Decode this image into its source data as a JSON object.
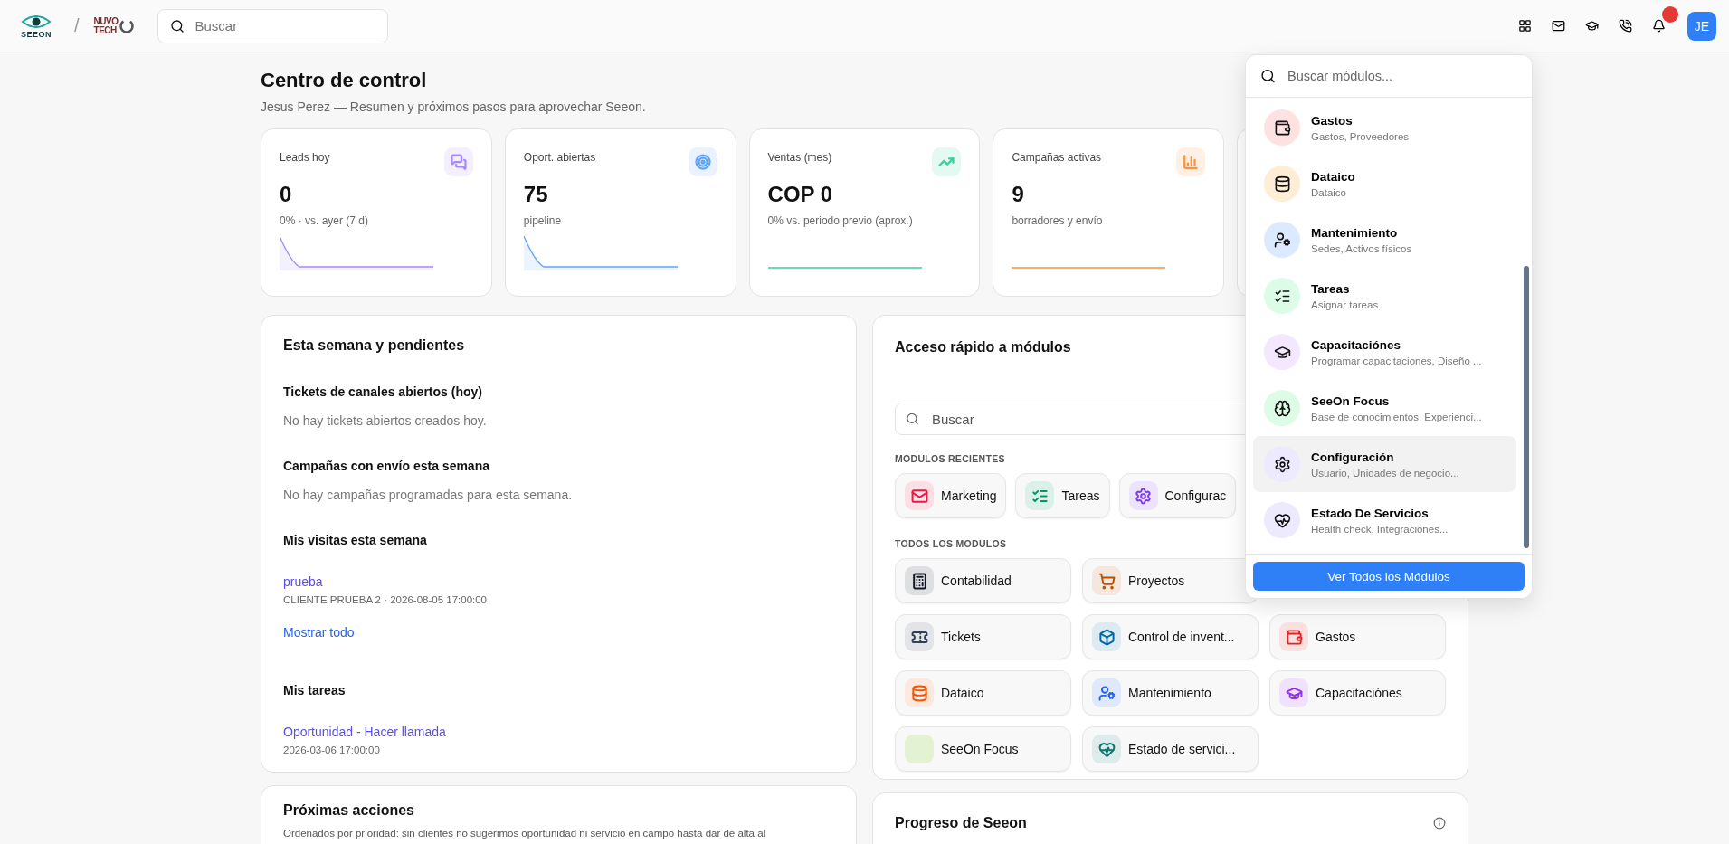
{
  "header": {
    "logo_text": "SEEON",
    "partner_logo_lines": [
      "NUVO",
      "TECH"
    ],
    "separator": "/",
    "search": {
      "placeholder": "Buscar"
    },
    "notification_badge": true,
    "avatar": "JE"
  },
  "page": {
    "title": "Centro de control",
    "subtitle": "Jesus Perez — Resumen y próximos pasos para aprovechar Seeon."
  },
  "stats": [
    {
      "label": "Leads hoy",
      "value": "0",
      "note": "0% · vs. ayer (7 d)",
      "kind": "chat",
      "color": "#a78bfa"
    },
    {
      "label": "Oport. abiertas",
      "value": "75",
      "note": "pipeline",
      "kind": "target",
      "color": "#60a5fa"
    },
    {
      "label": "Ventas (mes)",
      "value": "COP 0",
      "note": "0% vs. periodo previo (aprox.)",
      "kind": "trend",
      "color": "#34d399"
    },
    {
      "label": "Campañas activas",
      "value": "9",
      "note": "borradores y envío",
      "kind": "chart",
      "color": "#fb923c"
    },
    {
      "kind": "hidden"
    }
  ],
  "week": {
    "title": "Esta semana y pendientes",
    "sections": [
      {
        "title": "Tickets de canales abiertos (hoy)",
        "empty": "No hay tickets abiertos creados hoy."
      },
      {
        "title": "Campañas con envío esta semana",
        "empty": "No hay campañas programadas para esta semana."
      },
      {
        "title": "Mis visitas esta semana",
        "items": [
          {
            "link": "prueba",
            "meta": "CLIENTE PRUEBA 2 · 2026-08-05 17:00:00"
          }
        ],
        "more": "Mostrar todo"
      },
      {
        "title": "Mis tareas",
        "items": [
          {
            "link": "Oportunidad - Hacer llamada",
            "meta": "2026-03-06 17:00:00"
          }
        ]
      }
    ]
  },
  "quick_access": {
    "title": "Acceso rápido a módulos",
    "search": {
      "placeholder": "Buscar"
    },
    "recent_label": "MODULOS RECIENTES",
    "recent": [
      {
        "label": "Marketing",
        "kind": "mail",
        "color": "#e11d48"
      },
      {
        "label": "Tareas",
        "kind": "checklist",
        "color": "#059669"
      },
      {
        "label": "Configurac",
        "kind": "gear",
        "color": "#7c3aed"
      }
    ],
    "all_label": "TODOS LOS MODULOS",
    "all_rows": [
      [
        {
          "label": "Contabilidad",
          "kind": "calculator",
          "color": "#111827"
        },
        {
          "label": "Proyectos",
          "kind": "cart",
          "color": "#b45309"
        }
      ],
      [
        {
          "label": "Tickets",
          "kind": "ticket",
          "color": "#334155"
        },
        {
          "label": "Control de invent...",
          "kind": "box",
          "color": "#0369a1"
        },
        {
          "label": "Gastos",
          "kind": "wallet",
          "color": "#dc2626"
        }
      ],
      [
        {
          "label": "Dataico",
          "kind": "database",
          "color": "#ea580c"
        },
        {
          "label": "Mantenimiento",
          "kind": "usercog",
          "color": "#2563eb"
        },
        {
          "label": "Capacitaciónes",
          "kind": "cap",
          "color": "#9333ea"
        }
      ],
      [
        {
          "label": "SeeOn Focus",
          "kind": "blank",
          "color": "#e4f2d4"
        },
        {
          "label": "Estado de servici...",
          "kind": "heart",
          "color": "#0f766e"
        }
      ]
    ]
  },
  "next_actions": {
    "title": "Próximas acciones",
    "text": "Ordenados por prioridad: sin clientes no sugerimos oportunidad ni servicio en campo hasta dar de alta al"
  },
  "progress": {
    "title": "Progreso de Seeon"
  },
  "module_menu": {
    "search": {
      "placeholder": "Buscar módulos..."
    },
    "items": [
      {
        "title": "Gastos",
        "sub": "Gastos, Proveedores",
        "kind": "wallet",
        "color": "#fee2e2",
        "highlighted": false
      },
      {
        "title": "Dataico",
        "sub": "Dataico",
        "kind": "database",
        "color": "#ffedd5",
        "highlighted": false
      },
      {
        "title": "Mantenimiento",
        "sub": "Sedes, Activos físicos",
        "kind": "usercog",
        "color": "#dbeafe",
        "highlighted": false
      },
      {
        "title": "Tareas",
        "sub": "Asignar tareas",
        "kind": "checklist",
        "color": "#dcfce7",
        "highlighted": false
      },
      {
        "title": "Capacitaciónes",
        "sub": "Programar capacitaciones, Diseño ...",
        "kind": "cap",
        "color": "#f3e8ff",
        "highlighted": false
      },
      {
        "title": "SeeOn Focus",
        "sub": "Base de conocimientos, Experienci...",
        "kind": "brain",
        "color": "#dcfce7",
        "highlighted": false
      },
      {
        "title": "Configuración",
        "sub": "Usuario, Unidades de negocio...",
        "kind": "gear",
        "color": "#ede9fe",
        "highlighted": true
      },
      {
        "title": "Estado De Servicios",
        "sub": "Health check, Integraciones...",
        "kind": "heart",
        "color": "#ede9fe",
        "highlighted": false
      }
    ],
    "button": "Ver Todos los Módulos"
  }
}
